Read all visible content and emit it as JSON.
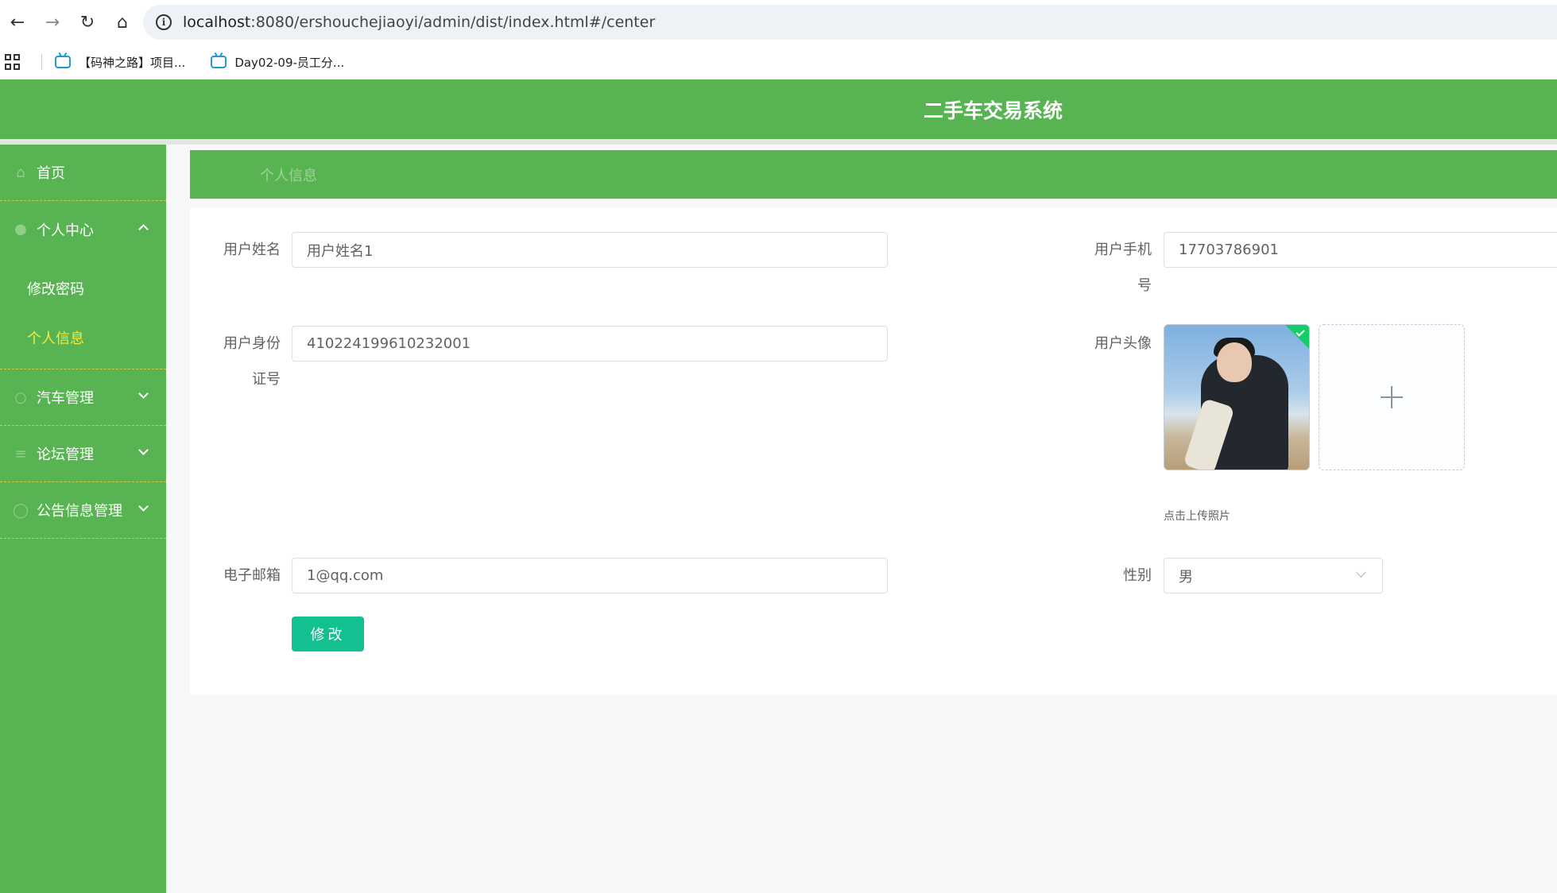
{
  "browser": {
    "url_host": "localhost",
    "url_path": ":8080/ershouchejiaoyi/admin/dist/index.html#/center",
    "bookmarks": [
      {
        "label": "【码神之路】项目..."
      },
      {
        "label": "Day02-09-员工分..."
      }
    ]
  },
  "app": {
    "title": "二手车交易系统"
  },
  "sidebar": {
    "items": [
      {
        "label": "首页",
        "icon": "home-icon"
      },
      {
        "label": "个人中心",
        "icon": "user-icon",
        "expanded": true,
        "children": [
          {
            "label": "修改密码",
            "active": false
          },
          {
            "label": "个人信息",
            "active": true
          }
        ]
      },
      {
        "label": "汽车管理",
        "icon": "car-icon"
      },
      {
        "label": "论坛管理",
        "icon": "menu-icon"
      },
      {
        "label": "公告信息管理",
        "icon": "notice-icon"
      }
    ]
  },
  "breadcrumb": {
    "current": "个人信息"
  },
  "form": {
    "username_label": "用户姓名",
    "username_value": "用户姓名1",
    "phone_label_line1": "用户手机",
    "phone_label_line2": "号",
    "phone_value": "17703786901",
    "idcard_label_line1": "用户身份",
    "idcard_label_line2": "证号",
    "idcard_value": "410224199610232001",
    "avatar_label": "用户头像",
    "upload_tip": "点击上传照片",
    "email_label": "电子邮箱",
    "email_value": "1@qq.com",
    "gender_label": "性别",
    "gender_value": "男",
    "submit_label": "修改"
  },
  "colors": {
    "primary_green": "#58b452",
    "active_menu_text": "#f7e93f",
    "button_teal": "#13c091"
  }
}
